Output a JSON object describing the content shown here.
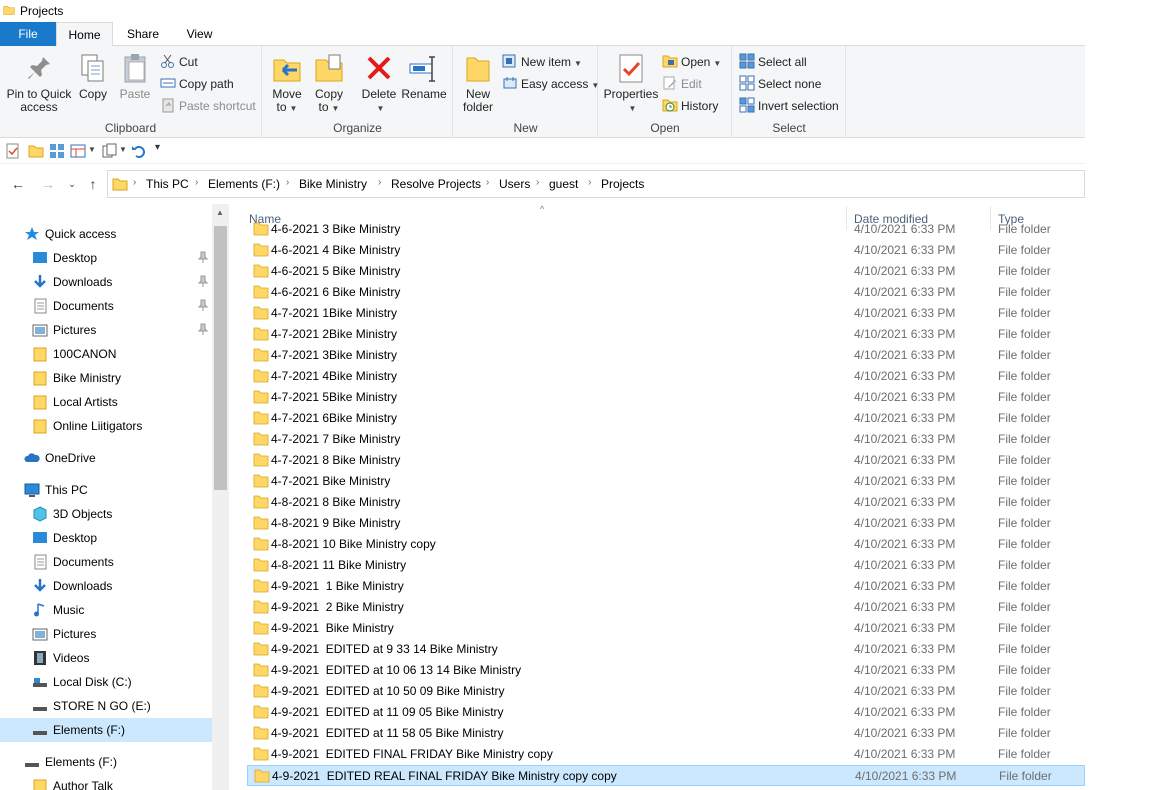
{
  "window": {
    "title": "Projects"
  },
  "ribbon_tabs": [
    "File",
    "Home",
    "Share",
    "View"
  ],
  "ribbon": {
    "clipboard": {
      "label": "Clipboard",
      "pin_line1": "Pin to Quick",
      "pin_line2": "access",
      "copy": "Copy",
      "paste": "Paste",
      "cut": "Cut",
      "copy_path": "Copy path",
      "paste_shortcut": "Paste shortcut"
    },
    "organize": {
      "label": "Organize",
      "move_line1": "Move",
      "move_line2": "to",
      "copy_line1": "Copy",
      "copy_line2": "to",
      "delete": "Delete",
      "rename": "Rename"
    },
    "new": {
      "label": "New",
      "folder_line1": "New",
      "folder_line2": "folder",
      "new_item": "New item",
      "easy_access": "Easy access"
    },
    "open": {
      "label": "Open",
      "properties": "Properties",
      "open": "Open",
      "edit": "Edit",
      "history": "History"
    },
    "select": {
      "label": "Select",
      "select_all": "Select all",
      "select_none": "Select none",
      "invert": "Invert selection"
    }
  },
  "address": {
    "crumbs": [
      "This PC",
      "Elements (F:)",
      "Bike Ministry",
      "Resolve Projects",
      "Users",
      "guest",
      "Projects"
    ]
  },
  "nav": {
    "quick_access": "Quick access",
    "quick_items": [
      "Desktop",
      "Downloads",
      "Documents",
      "Pictures",
      "100CANON",
      "Bike Ministry",
      "Local Artists",
      "Online Liitigators"
    ],
    "onedrive": "OneDrive",
    "this_pc": "This PC",
    "pc_items": [
      "3D Objects",
      "Desktop",
      "Documents",
      "Downloads",
      "Music",
      "Pictures",
      "Videos",
      "Local Disk (C:)",
      "STORE N GO (E:)",
      "Elements (F:)"
    ],
    "elements_root": "Elements (F:)",
    "elements_child": "Author Talk"
  },
  "columns": {
    "name": "Name",
    "date": "Date modified",
    "type": "File folder",
    "type_header": "Type"
  },
  "files": [
    {
      "name": "4-6-2021 3 Bike Ministry",
      "date": "4/10/2021 6:33 PM",
      "type": "File folder"
    },
    {
      "name": "4-6-2021 4 Bike Ministry",
      "date": "4/10/2021 6:33 PM",
      "type": "File folder"
    },
    {
      "name": "4-6-2021 5 Bike Ministry",
      "date": "4/10/2021 6:33 PM",
      "type": "File folder"
    },
    {
      "name": "4-6-2021 6 Bike Ministry",
      "date": "4/10/2021 6:33 PM",
      "type": "File folder"
    },
    {
      "name": "4-7-2021 1Bike Ministry",
      "date": "4/10/2021 6:33 PM",
      "type": "File folder"
    },
    {
      "name": "4-7-2021 2Bike Ministry",
      "date": "4/10/2021 6:33 PM",
      "type": "File folder"
    },
    {
      "name": "4-7-2021 3Bike Ministry",
      "date": "4/10/2021 6:33 PM",
      "type": "File folder"
    },
    {
      "name": "4-7-2021 4Bike Ministry",
      "date": "4/10/2021 6:33 PM",
      "type": "File folder"
    },
    {
      "name": "4-7-2021 5Bike Ministry",
      "date": "4/10/2021 6:33 PM",
      "type": "File folder"
    },
    {
      "name": "4-7-2021 6Bike Ministry",
      "date": "4/10/2021 6:33 PM",
      "type": "File folder"
    },
    {
      "name": "4-7-2021 7 Bike Ministry",
      "date": "4/10/2021 6:33 PM",
      "type": "File folder"
    },
    {
      "name": "4-7-2021 8 Bike Ministry",
      "date": "4/10/2021 6:33 PM",
      "type": "File folder"
    },
    {
      "name": "4-7-2021 Bike Ministry",
      "date": "4/10/2021 6:33 PM",
      "type": "File folder"
    },
    {
      "name": "4-8-2021 8 Bike Ministry",
      "date": "4/10/2021 6:33 PM",
      "type": "File folder"
    },
    {
      "name": "4-8-2021 9 Bike Ministry",
      "date": "4/10/2021 6:33 PM",
      "type": "File folder"
    },
    {
      "name": "4-8-2021 10 Bike Ministry copy",
      "date": "4/10/2021 6:33 PM",
      "type": "File folder"
    },
    {
      "name": "4-8-2021 11 Bike Ministry",
      "date": "4/10/2021 6:33 PM",
      "type": "File folder"
    },
    {
      "name": "4-9-2021  1 Bike Ministry",
      "date": "4/10/2021 6:33 PM",
      "type": "File folder"
    },
    {
      "name": "4-9-2021  2 Bike Ministry",
      "date": "4/10/2021 6:33 PM",
      "type": "File folder"
    },
    {
      "name": "4-9-2021  Bike Ministry",
      "date": "4/10/2021 6:33 PM",
      "type": "File folder"
    },
    {
      "name": "4-9-2021  EDITED at 9 33 14 Bike Ministry",
      "date": "4/10/2021 6:33 PM",
      "type": "File folder"
    },
    {
      "name": "4-9-2021  EDITED at 10 06 13 14 Bike Ministry",
      "date": "4/10/2021 6:33 PM",
      "type": "File folder"
    },
    {
      "name": "4-9-2021  EDITED at 10 50 09 Bike Ministry",
      "date": "4/10/2021 6:33 PM",
      "type": "File folder"
    },
    {
      "name": "4-9-2021  EDITED at 11 09 05 Bike Ministry",
      "date": "4/10/2021 6:33 PM",
      "type": "File folder"
    },
    {
      "name": "4-9-2021  EDITED at 11 58 05 Bike Ministry",
      "date": "4/10/2021 6:33 PM",
      "type": "File folder"
    },
    {
      "name": "4-9-2021  EDITED FINAL FRIDAY Bike Ministry copy",
      "date": "4/10/2021 6:33 PM",
      "type": "File folder"
    },
    {
      "name": "4-9-2021  EDITED REAL FINAL FRIDAY Bike Ministry copy copy",
      "date": "4/10/2021 6:33 PM",
      "type": "File folder",
      "selected": true
    }
  ],
  "colors": {
    "file_tab": "#1979ca",
    "selection": "#cce8ff",
    "folder": "#ffd766"
  }
}
